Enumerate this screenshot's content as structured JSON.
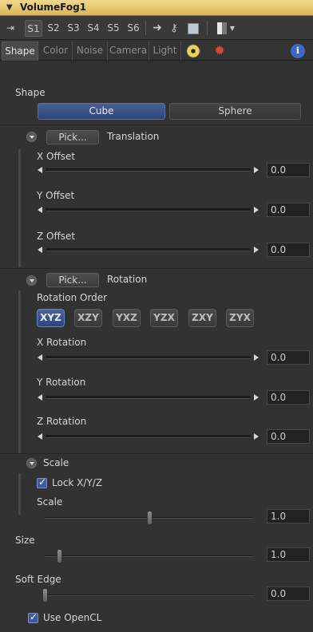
{
  "window": {
    "title": "VolumeFog1"
  },
  "toolbar": {
    "slots": [
      "S1",
      "S2",
      "S3",
      "S4",
      "S5",
      "S6"
    ],
    "active_slot": "S1"
  },
  "tabs": {
    "items": [
      "Shape",
      "Color",
      "Noise",
      "Camera",
      "Light"
    ],
    "active": "Shape",
    "info_glyph": "i"
  },
  "shape": {
    "label": "Shape",
    "cube_label": "Cube",
    "sphere_label": "Sphere",
    "selected": "Cube"
  },
  "translation": {
    "pick_label": "Pick...",
    "header": "Translation",
    "x_label": "X Offset",
    "x_value": "0.0",
    "y_label": "Y Offset",
    "y_value": "0.0",
    "z_label": "Z Offset",
    "z_value": "0.0"
  },
  "rotation": {
    "pick_label": "Pick...",
    "header": "Rotation",
    "order_label": "Rotation Order",
    "orders": [
      "XYZ",
      "XZY",
      "YXZ",
      "YZX",
      "ZXY",
      "ZYX"
    ],
    "selected_order": "XYZ",
    "x_label": "X Rotation",
    "x_value": "0.0",
    "y_label": "Y Rotation",
    "y_value": "0.0",
    "z_label": "Z Rotation",
    "z_value": "0.0"
  },
  "scale": {
    "header": "Scale",
    "lock_label": "Lock X/Y/Z",
    "lock_checked": true,
    "label": "Scale",
    "value": "1.0",
    "slider_fraction": 0.5
  },
  "size": {
    "label": "Size",
    "value": "1.0",
    "slider_fraction": 0.07
  },
  "soft_edge": {
    "label": "Soft Edge",
    "value": "0.0",
    "slider_fraction": 0.0
  },
  "opencl": {
    "label": "Use OpenCL",
    "checked": true
  },
  "colors": {
    "title_bar": "#e8c86f",
    "selected_button": "#3d5189",
    "panel_bg": "#323232"
  }
}
